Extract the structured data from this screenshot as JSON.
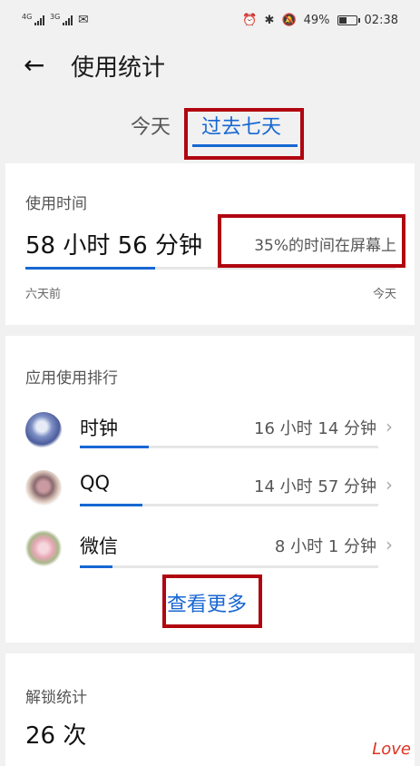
{
  "status": {
    "sim1": "4G",
    "sim2": "3G",
    "battery_text": "49%",
    "battery_level": 0.49,
    "time": "02:38"
  },
  "header": {
    "title": "使用统计"
  },
  "tabs": [
    {
      "label": "今天",
      "active": false
    },
    {
      "label": "过去七天",
      "active": true
    }
  ],
  "usage": {
    "section_title": "使用时间",
    "total": "58 小时 56 分钟",
    "screen_percent": "35%的时间在屏幕上",
    "progress": 0.35,
    "start_label": "六天前",
    "end_label": "今天"
  },
  "ranking": {
    "section_title": "应用使用排行",
    "apps": [
      {
        "name": "时钟",
        "time": "16 小时 14 分钟",
        "progress": 0.23,
        "icon": "clock-flower-icon"
      },
      {
        "name": "QQ",
        "time": "14 小时 57 分钟",
        "progress": 0.21,
        "icon": "qq-flower-icon"
      },
      {
        "name": "微信",
        "time": "8 小时 1 分钟",
        "progress": 0.11,
        "icon": "wechat-flower-icon"
      }
    ],
    "more_label": "查看更多"
  },
  "unlock": {
    "section_title": "解锁统计",
    "count": "26 次"
  },
  "watermark": "Love"
}
